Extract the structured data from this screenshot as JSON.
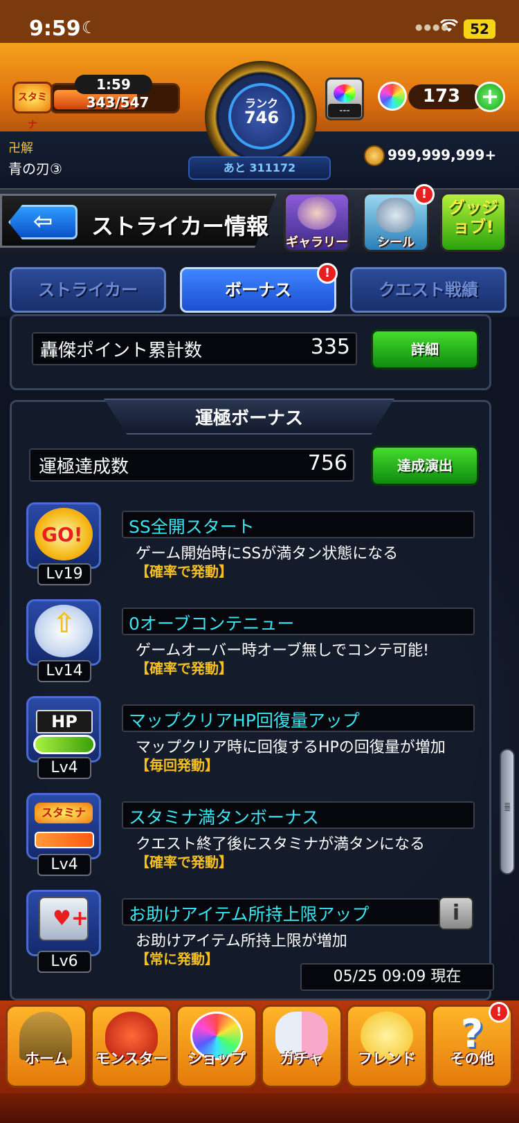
{
  "status_bar": {
    "time": "9:59",
    "battery": "52"
  },
  "player": {
    "stamina_timer": "1:59",
    "stamina_value": "343/547",
    "stamina_icon_label": "スタミナ",
    "rank_label": "ランク",
    "rank_value": "746",
    "rank_remaining": "あと 311172",
    "item_slot_value": "---",
    "orb_count": "173",
    "plus_label": "+",
    "title_label": "卍解",
    "title_name": "青の刃③",
    "coin_value": "999,999,999+"
  },
  "page_header": {
    "back_label": "⇦",
    "title": "ストライカー情報",
    "gallery_label": "ギャラリー",
    "seal_label": "シール",
    "goodjob_label": "グッジョブ!",
    "alert_label": "!"
  },
  "tabs": [
    {
      "label": "ストライカー",
      "active": false
    },
    {
      "label": "ボーナス",
      "active": true
    },
    {
      "label": "クエスト戦績",
      "active": false
    }
  ],
  "gouketsu": {
    "label": "轟傑ポイント累計数",
    "value": "335",
    "detail_button": "詳細"
  },
  "unkiwame": {
    "section_title": "運極ボーナス",
    "label": "運極達成数",
    "value": "756",
    "button": "達成演出"
  },
  "bonuses": [
    {
      "icon": "ss-go-icon",
      "level": "Lv19",
      "name": "SS全開スタート",
      "description": "ゲーム開始時にSSが満タン状態になる",
      "trigger": "【確率で発動】"
    },
    {
      "icon": "winged-arrow-icon",
      "level": "Lv14",
      "name": "0オーブコンテニュー",
      "description": "ゲームオーバー時オーブ無しでコンテ可能!",
      "trigger": "【確率で発動】"
    },
    {
      "icon": "hp-bar-icon",
      "level": "Lv4",
      "name": "マップクリアHP回復量アップ",
      "description": "マップクリア時に回復するHPの回復量が増加",
      "trigger": "【毎回発動】"
    },
    {
      "icon": "stamina-arrow-icon",
      "level": "Lv4",
      "name": "スタミナ満タンボーナス",
      "description": "クエスト終了後にスタミナが満タンになる",
      "trigger": "【確率で発動】"
    },
    {
      "icon": "help-item-icon",
      "level": "Lv6",
      "name": "お助けアイテム所持上限アップ",
      "description": "お助けアイテム所持上限が増加",
      "trigger": "【常に発動】"
    }
  ],
  "info_button_label": "i",
  "timestamp": "05/25 09:09 現在",
  "bottom_nav": [
    {
      "label": "ホーム",
      "icon": "home-door-icon"
    },
    {
      "label": "モンスター",
      "icon": "monster-icon"
    },
    {
      "label": "ショップ",
      "icon": "rainbow-orb-icon"
    },
    {
      "label": "ガチャ",
      "icon": "gacha-characters-icon"
    },
    {
      "label": "フレンド",
      "icon": "friends-icon"
    },
    {
      "label": "その他",
      "icon": "question-icon"
    }
  ],
  "colors": {
    "header_orange": "#f5a11c",
    "tab_active": "#3f86ff",
    "bonus_name": "#39e6f2",
    "trigger_text": "#f5c022",
    "green_button": "#44dc2c",
    "alert_red": "#e81f1f"
  }
}
